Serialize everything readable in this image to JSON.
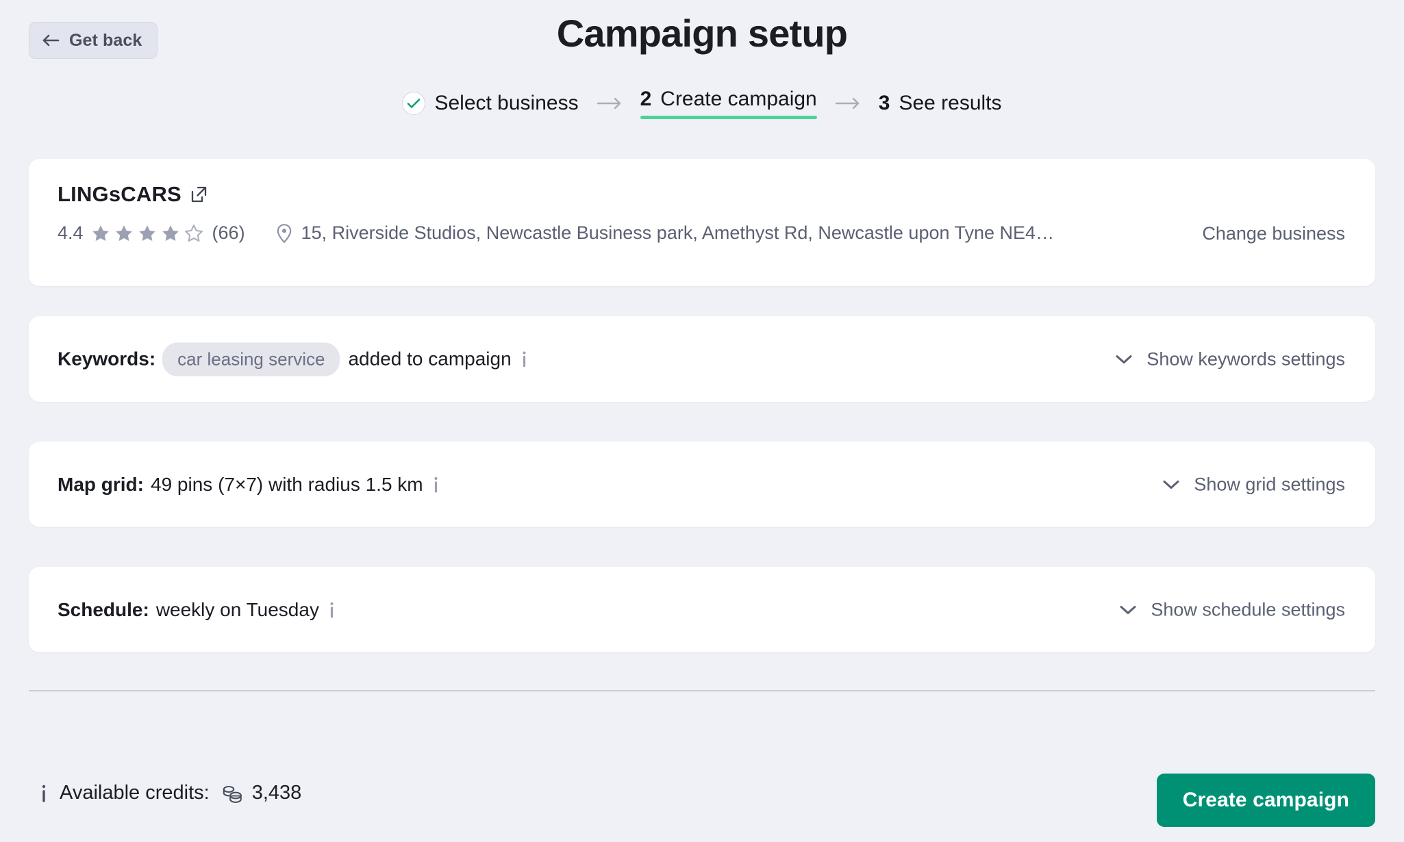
{
  "header": {
    "back_label": "Get back",
    "title": "Campaign setup"
  },
  "stepper": {
    "steps": [
      {
        "marker": "check",
        "label": "Select business",
        "state": "done"
      },
      {
        "marker": "2",
        "label": "Create campaign",
        "state": "active"
      },
      {
        "marker": "3",
        "label": "See results",
        "state": "upcoming"
      }
    ],
    "separator": "→",
    "active_underline_color": "#4fd19a"
  },
  "business": {
    "name": "LINGsCARS",
    "external_link_icon": "external-link-icon",
    "rating": "4.4",
    "stars_filled": 4,
    "stars_total": 5,
    "review_count": "(66)",
    "address": "15, Riverside Studios, Newcastle Business park, Amethyst Rd, Newcastle upon Tyne NE4…",
    "change_label": "Change business"
  },
  "rows": [
    {
      "id": "keywords",
      "label": "Keywords:",
      "chip": "car leasing service",
      "text": "added to campaign",
      "toggle_label": "Show keywords settings"
    },
    {
      "id": "grid",
      "label": "Map grid:",
      "chip": null,
      "text": "49 pins (7×7) with radius 1.5 km",
      "toggle_label": "Show grid settings"
    },
    {
      "id": "schedule",
      "label": "Schedule:",
      "chip": null,
      "text": "weekly on Tuesday",
      "toggle_label": "Show schedule settings"
    }
  ],
  "footer": {
    "credits_label": "Available credits:",
    "credits_value": "3,438",
    "credits_icon": "coins-icon",
    "submit_label": "Create campaign",
    "submit_color": "#009175"
  }
}
